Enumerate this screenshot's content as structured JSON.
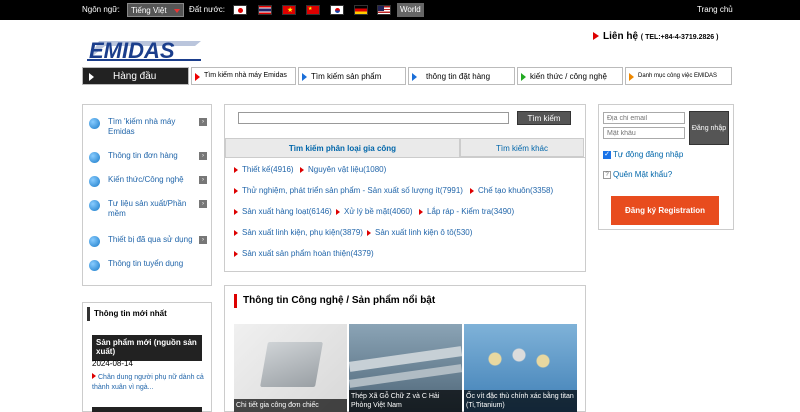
{
  "topbar": {
    "lang_label": "Ngôn ngữ:",
    "lang_value": "Tiếng Việt",
    "country_label": "Đất nước:",
    "flags": [
      "Japan",
      "Thailand",
      "Vietnam",
      "China",
      "Korea",
      "Germany",
      "USA"
    ],
    "world": "World",
    "home": "Trang chủ"
  },
  "header": {
    "logo": "EMIDAS",
    "contact": "Liên hệ",
    "tel": "( TEL:+84-4-3719.2826 )"
  },
  "nav": [
    "Hàng đầu",
    "Tìm kiếm nhà máy Emidas",
    "Tìm kiếm sản phẩm",
    "thông tin đặt hàng",
    "kiến thức / công nghệ",
    "Danh mục công việc EMIDAS"
  ],
  "sidebar": [
    "Tìm 'kiếm nhà máy Emidas",
    "Thông tin đơn hàng",
    "Kiến thức/Công nghệ",
    "Tư liệu sản xuất/Phần mềm",
    "Thiết bị đã qua sử dụng",
    "Thông tin tuyển dụng"
  ],
  "news": {
    "heading": "Thông tin mới nhất",
    "box_title": "Sản phẩm mới (nguồn sản xuất)",
    "date": "2024-08-14",
    "item": "Chân dung người phụ nữ dành cả thành xuân vì ngà..."
  },
  "search": {
    "button": "Tìm kiếm",
    "tab_active": "Tìm kiếm phân loại gia công",
    "tab_other": "Tìm kiếm khác",
    "categories": [
      "Thiết kế(4916)",
      "Nguyên vật liệu(1080)",
      "Thử nghiệm, phát triển sản phẩm - Sản xuất số lượng ít(7991)",
      "Chế tạo khuôn(3358)",
      "Sản xuất hàng loạt(6146)",
      "Xử lý bề mặt(4060)",
      "Lắp ráp - Kiểm tra(3490)",
      "Sản xuất linh kiện, phụ kiện(3879)",
      "Sản xuất linh kiện ô tô(530)",
      "Sản xuất sản phẩm hoàn thiện(4379)"
    ]
  },
  "featured": {
    "heading": "Thông tin Công nghệ / Sản phẩm nổi bật",
    "items": [
      "Chi tiết gia công đơn chiếc",
      "Thép Xã Gỗ Chữ Z và C Hải Phòng Việt Nam",
      "Ốc vít đặc thù chính xác bằng titan (Ti,Titanium)"
    ]
  },
  "login": {
    "email_placeholder": "Địa chỉ email",
    "password_placeholder": "Mật khẩu",
    "login_button": "Đăng nhập",
    "auto_login": "Tự động đăng nhập",
    "forgot": "Quên Mật khẩu?",
    "register": "Đăng ký Registration"
  }
}
